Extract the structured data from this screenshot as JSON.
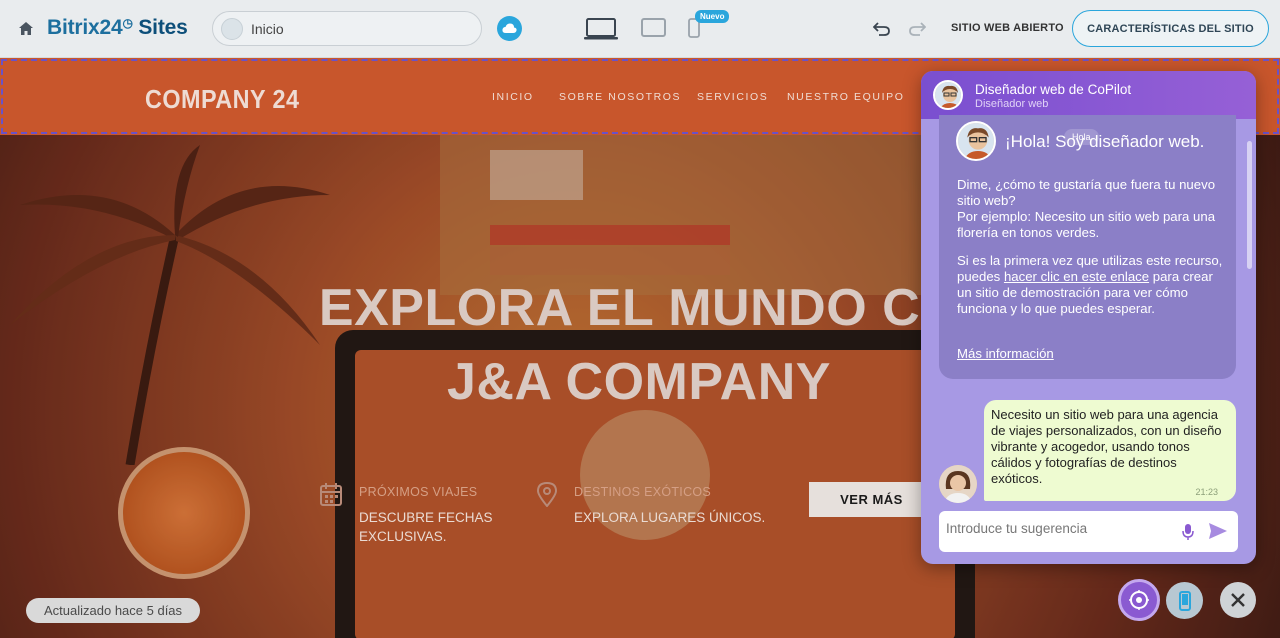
{
  "toolbar": {
    "logo_main": "Bitrix24",
    "logo_sites": "Sites",
    "address": "Inicio",
    "new_badge": "Nuevo",
    "open_site_label": "SITIO WEB ABIERTO",
    "features_label": "CARACTERÍSTICAS DEL SITIO"
  },
  "site": {
    "logo": "COMPANY 24",
    "nav": [
      "INICIO",
      "SOBRE NOSOTROS",
      "SERVICIOS",
      "NUESTRO EQUIPO"
    ],
    "headline_1": "EXPLORA EL MUNDO CO",
    "headline_2": "J&A COMPANY",
    "features": [
      {
        "title": "PRÓXIMOS VIAJES",
        "desc": "DESCUBRE FECHAS EXCLUSIVAS.",
        "icon": "calendar-icon"
      },
      {
        "title": "DESTINOS EXÓTICOS",
        "desc": "EXPLORA LUGARES ÚNICOS.",
        "icon": "location-pin-icon"
      }
    ],
    "cta": "VER MÁS"
  },
  "status": {
    "updated": "Actualizado hace 5 días"
  },
  "chat": {
    "title": "Diseñador web de CoPilot",
    "subtitle": "Diseñador web",
    "hello": "¡Hola! Soy diseñador web.",
    "hi_tag": "Hola",
    "p1": "Dime, ¿cómo te gustaría que fuera tu nuevo sitio web?",
    "p2": "Por ejemplo: Necesito un sitio web para una florería en tonos verdes.",
    "p3_before": "Si es la primera vez que utilizas este recurso, puedes ",
    "p3_link": "hacer clic en este enlace",
    "p3_after": " para crear un sitio de demostración para ver cómo funciona y lo que puedes esperar.",
    "more_info": "Más información",
    "user_message": "Necesito un sitio web para una agencia de viajes personalizados, con un diseño vibrante y acogedor, usando tonos cálidos y fotografías de destinos exóticos.",
    "user_time": "21:23",
    "input_placeholder": "Introduce tu sugerencia"
  },
  "colors": {
    "accent": "#2aa6dc",
    "copilot_purple": "#7a4fd0",
    "site_header": "#c8562c",
    "user_bubble": "#eefbd1"
  }
}
